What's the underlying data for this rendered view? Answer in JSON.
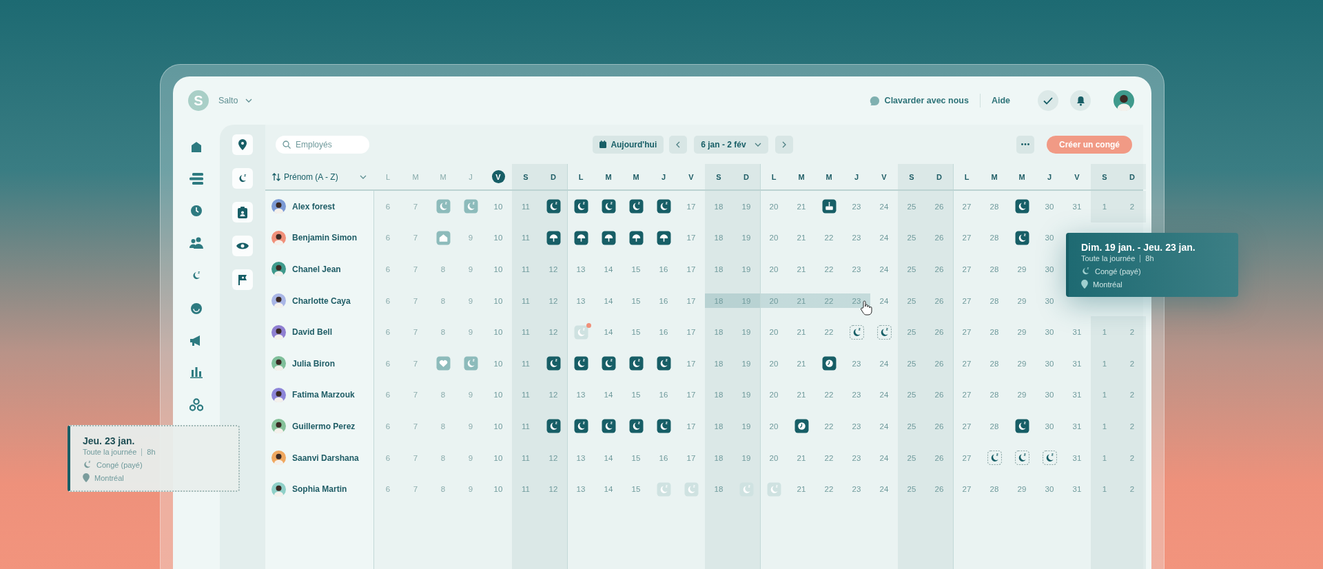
{
  "brand": {
    "initial": "S",
    "name": "Salto"
  },
  "header": {
    "chat": "Clavarder avec nous",
    "help": "Aide"
  },
  "toolbar": {
    "search": {
      "placeholder": "Employés"
    },
    "today": "Aujourd'hui",
    "range": "6 jan - 2 fév",
    "create": "Créer un congé"
  },
  "sort_label": "Prénom (A - Z)",
  "days": [
    {
      "letter": "L",
      "weekend": false,
      "past": true,
      "today": false
    },
    {
      "letter": "M",
      "weekend": false,
      "past": true,
      "today": false
    },
    {
      "letter": "M",
      "weekend": false,
      "past": true,
      "today": false
    },
    {
      "letter": "J",
      "weekend": false,
      "past": true,
      "today": false
    },
    {
      "letter": "V",
      "weekend": false,
      "past": false,
      "today": true
    },
    {
      "letter": "S",
      "weekend": true,
      "past": false,
      "today": false
    },
    {
      "letter": "D",
      "weekend": true,
      "past": false,
      "today": false
    },
    {
      "letter": "L",
      "weekend": false,
      "past": false,
      "today": false
    },
    {
      "letter": "M",
      "weekend": false,
      "past": false,
      "today": false
    },
    {
      "letter": "M",
      "weekend": false,
      "past": false,
      "today": false
    },
    {
      "letter": "J",
      "weekend": false,
      "past": false,
      "today": false
    },
    {
      "letter": "V",
      "weekend": false,
      "past": false,
      "today": false
    },
    {
      "letter": "S",
      "weekend": true,
      "past": false,
      "today": false
    },
    {
      "letter": "D",
      "weekend": true,
      "past": false,
      "today": false
    },
    {
      "letter": "L",
      "weekend": false,
      "past": false,
      "today": false
    },
    {
      "letter": "M",
      "weekend": false,
      "past": false,
      "today": false
    },
    {
      "letter": "M",
      "weekend": false,
      "past": false,
      "today": false
    },
    {
      "letter": "J",
      "weekend": false,
      "past": false,
      "today": false
    },
    {
      "letter": "V",
      "weekend": false,
      "past": false,
      "today": false
    },
    {
      "letter": "S",
      "weekend": true,
      "past": false,
      "today": false
    },
    {
      "letter": "D",
      "weekend": true,
      "past": false,
      "today": false
    },
    {
      "letter": "L",
      "weekend": false,
      "past": false,
      "today": false
    },
    {
      "letter": "M",
      "weekend": false,
      "past": false,
      "today": false
    },
    {
      "letter": "M",
      "weekend": false,
      "past": false,
      "today": false
    },
    {
      "letter": "J",
      "weekend": false,
      "past": false,
      "today": false
    },
    {
      "letter": "V",
      "weekend": false,
      "past": false,
      "today": false
    },
    {
      "letter": "S",
      "weekend": true,
      "past": false,
      "today": false
    },
    {
      "letter": "D",
      "weekend": true,
      "past": false,
      "today": false
    }
  ],
  "rows": [
    {
      "name": "Alex forest",
      "cells": [
        {
          "kind": "day",
          "text": "6",
          "selected": false
        },
        {
          "kind": "day",
          "text": "7",
          "selected": false
        },
        {
          "kind": "timeoff",
          "pending": false,
          "muted": false,
          "alert": false,
          "selected": false
        },
        {
          "kind": "timeoff",
          "pending": false,
          "muted": false,
          "alert": false,
          "selected": false
        },
        {
          "kind": "day",
          "text": "10",
          "selected": false
        },
        {
          "kind": "day",
          "text": "11",
          "selected": false
        },
        {
          "kind": "timeoff",
          "pending": false,
          "muted": false,
          "alert": false,
          "selected": false
        },
        {
          "kind": "timeoff",
          "pending": false,
          "muted": false,
          "alert": false,
          "selected": false
        },
        {
          "kind": "timeoff",
          "pending": false,
          "muted": false,
          "alert": false,
          "selected": false
        },
        {
          "kind": "timeoff",
          "pending": false,
          "muted": false,
          "alert": false,
          "selected": false
        },
        {
          "kind": "timeoff",
          "pending": false,
          "muted": false,
          "alert": false,
          "selected": false
        },
        {
          "kind": "day",
          "text": "17",
          "selected": false
        },
        {
          "kind": "day",
          "text": "18",
          "selected": false
        },
        {
          "kind": "day",
          "text": "19",
          "selected": false
        },
        {
          "kind": "day",
          "text": "20",
          "selected": false
        },
        {
          "kind": "day",
          "text": "21",
          "selected": false
        },
        {
          "kind": "birthday",
          "pending": false,
          "muted": false,
          "alert": false,
          "selected": false
        },
        {
          "kind": "day",
          "text": "23",
          "selected": false
        },
        {
          "kind": "day",
          "text": "24",
          "selected": false
        },
        {
          "kind": "day",
          "text": "25",
          "selected": false
        },
        {
          "kind": "day",
          "text": "26",
          "selected": false
        },
        {
          "kind": "day",
          "text": "27",
          "selected": false
        },
        {
          "kind": "day",
          "text": "28",
          "selected": false
        },
        {
          "kind": "timeoff",
          "pending": false,
          "muted": false,
          "alert": false,
          "selected": false
        },
        {
          "kind": "day",
          "text": "30",
          "selected": false
        },
        {
          "kind": "day",
          "text": "31",
          "selected": false
        },
        {
          "kind": "day",
          "text": "1",
          "selected": false
        },
        {
          "kind": "day",
          "text": "2",
          "selected": false
        }
      ]
    },
    {
      "name": "Benjamin Simon",
      "cells": [
        {
          "kind": "day",
          "text": "6",
          "selected": false
        },
        {
          "kind": "day",
          "text": "7",
          "selected": false
        },
        {
          "kind": "remote",
          "pending": false,
          "muted": false,
          "alert": false,
          "selected": false
        },
        {
          "kind": "day",
          "text": "9",
          "selected": false
        },
        {
          "kind": "day",
          "text": "10",
          "selected": false
        },
        {
          "kind": "day",
          "text": "11",
          "selected": false
        },
        {
          "kind": "vacation",
          "pending": false,
          "muted": false,
          "alert": false,
          "selected": false
        },
        {
          "kind": "vacation",
          "pending": false,
          "muted": false,
          "alert": false,
          "selected": false
        },
        {
          "kind": "vacation",
          "pending": false,
          "muted": false,
          "alert": false,
          "selected": false
        },
        {
          "kind": "vacation",
          "pending": false,
          "muted": false,
          "alert": false,
          "selected": false
        },
        {
          "kind": "vacation",
          "pending": false,
          "muted": false,
          "alert": false,
          "selected": false
        },
        {
          "kind": "day",
          "text": "17",
          "selected": false
        },
        {
          "kind": "day",
          "text": "18",
          "selected": false
        },
        {
          "kind": "day",
          "text": "19",
          "selected": false
        },
        {
          "kind": "day",
          "text": "20",
          "selected": false
        },
        {
          "kind": "day",
          "text": "21",
          "selected": false
        },
        {
          "kind": "day",
          "text": "22",
          "selected": false
        },
        {
          "kind": "day",
          "text": "23",
          "selected": false
        },
        {
          "kind": "day",
          "text": "24",
          "selected": false
        },
        {
          "kind": "day",
          "text": "25",
          "selected": false
        },
        {
          "kind": "day",
          "text": "26",
          "selected": false
        },
        {
          "kind": "day",
          "text": "27",
          "selected": false
        },
        {
          "kind": "day",
          "text": "28",
          "selected": false
        },
        {
          "kind": "timeoff",
          "pending": false,
          "muted": false,
          "alert": false,
          "selected": false
        },
        {
          "kind": "day",
          "text": "30",
          "selected": false
        }
      ]
    },
    {
      "name": "Chanel Jean",
      "cells": [
        {
          "kind": "day",
          "text": "6",
          "selected": false
        },
        {
          "kind": "day",
          "text": "7",
          "selected": false
        },
        {
          "kind": "day",
          "text": "8",
          "selected": false
        },
        {
          "kind": "day",
          "text": "9",
          "selected": false
        },
        {
          "kind": "day",
          "text": "10",
          "selected": false
        },
        {
          "kind": "day",
          "text": "11",
          "selected": false
        },
        {
          "kind": "day",
          "text": "12",
          "selected": false
        },
        {
          "kind": "day",
          "text": "13",
          "selected": false
        },
        {
          "kind": "day",
          "text": "14",
          "selected": false
        },
        {
          "kind": "day",
          "text": "15",
          "selected": false
        },
        {
          "kind": "day",
          "text": "16",
          "selected": false
        },
        {
          "kind": "day",
          "text": "17",
          "selected": false
        },
        {
          "kind": "day",
          "text": "18",
          "selected": false
        },
        {
          "kind": "day",
          "text": "19",
          "selected": false
        },
        {
          "kind": "day",
          "text": "20",
          "selected": false
        },
        {
          "kind": "day",
          "text": "21",
          "selected": false
        },
        {
          "kind": "day",
          "text": "22",
          "selected": false
        },
        {
          "kind": "day",
          "text": "23",
          "selected": false
        },
        {
          "kind": "day",
          "text": "24",
          "selected": false
        },
        {
          "kind": "day",
          "text": "25",
          "selected": false
        },
        {
          "kind": "day",
          "text": "26",
          "selected": false
        },
        {
          "kind": "day",
          "text": "27",
          "selected": false
        },
        {
          "kind": "day",
          "text": "28",
          "selected": false
        },
        {
          "kind": "day",
          "text": "29",
          "selected": false
        },
        {
          "kind": "day",
          "text": "30",
          "selected": false
        }
      ]
    },
    {
      "name": "Charlotte Caya",
      "cells": [
        {
          "kind": "day",
          "text": "6",
          "selected": false
        },
        {
          "kind": "day",
          "text": "7",
          "selected": false
        },
        {
          "kind": "day",
          "text": "8",
          "selected": false
        },
        {
          "kind": "day",
          "text": "9",
          "selected": false
        },
        {
          "kind": "day",
          "text": "10",
          "selected": false
        },
        {
          "kind": "day",
          "text": "11",
          "selected": false
        },
        {
          "kind": "day",
          "text": "12",
          "selected": false
        },
        {
          "kind": "day",
          "text": "13",
          "selected": false
        },
        {
          "kind": "day",
          "text": "14",
          "selected": false
        },
        {
          "kind": "day",
          "text": "15",
          "selected": false
        },
        {
          "kind": "day",
          "text": "16",
          "selected": false
        },
        {
          "kind": "day",
          "text": "17",
          "selected": false
        },
        {
          "kind": "day",
          "text": "18",
          "selected": true
        },
        {
          "kind": "day",
          "text": "19",
          "selected": true
        },
        {
          "kind": "day",
          "text": "20",
          "selected": true
        },
        {
          "kind": "day",
          "text": "21",
          "selected": true
        },
        {
          "kind": "day",
          "text": "22",
          "selected": true
        },
        {
          "kind": "day",
          "text": "23",
          "selected": true
        },
        {
          "kind": "day",
          "text": "24",
          "selected": false
        },
        {
          "kind": "day",
          "text": "25",
          "selected": false
        },
        {
          "kind": "day",
          "text": "26",
          "selected": false
        },
        {
          "kind": "day",
          "text": "27",
          "selected": false
        },
        {
          "kind": "day",
          "text": "28",
          "selected": false
        },
        {
          "kind": "day",
          "text": "29",
          "selected": false
        },
        {
          "kind": "day",
          "text": "30",
          "selected": false
        }
      ]
    },
    {
      "name": "David Bell",
      "cells": [
        {
          "kind": "day",
          "text": "6",
          "selected": false
        },
        {
          "kind": "day",
          "text": "7",
          "selected": false
        },
        {
          "kind": "day",
          "text": "8",
          "selected": false
        },
        {
          "kind": "day",
          "text": "9",
          "selected": false
        },
        {
          "kind": "day",
          "text": "10",
          "selected": false
        },
        {
          "kind": "day",
          "text": "11",
          "selected": false
        },
        {
          "kind": "day",
          "text": "12",
          "selected": false
        },
        {
          "kind": "timeoff",
          "pending": false,
          "muted": true,
          "alert": true,
          "selected": false
        },
        {
          "kind": "day",
          "text": "14",
          "selected": false
        },
        {
          "kind": "day",
          "text": "15",
          "selected": false
        },
        {
          "kind": "day",
          "text": "16",
          "selected": false
        },
        {
          "kind": "day",
          "text": "17",
          "selected": false
        },
        {
          "kind": "day",
          "text": "18",
          "selected": false
        },
        {
          "kind": "day",
          "text": "19",
          "selected": false
        },
        {
          "kind": "day",
          "text": "20",
          "selected": false
        },
        {
          "kind": "day",
          "text": "21",
          "selected": false
        },
        {
          "kind": "day",
          "text": "22",
          "selected": false
        },
        {
          "kind": "timeoff",
          "pending": true,
          "muted": false,
          "alert": false,
          "selected": false
        },
        {
          "kind": "timeoff",
          "pending": true,
          "muted": false,
          "alert": false,
          "selected": false
        },
        {
          "kind": "day",
          "text": "25",
          "selected": false
        },
        {
          "kind": "day",
          "text": "26",
          "selected": false
        },
        {
          "kind": "day",
          "text": "27",
          "selected": false
        },
        {
          "kind": "day",
          "text": "28",
          "selected": false
        },
        {
          "kind": "day",
          "text": "29",
          "selected": false
        },
        {
          "kind": "day",
          "text": "30",
          "selected": false
        },
        {
          "kind": "day",
          "text": "31",
          "selected": false
        },
        {
          "kind": "day",
          "text": "1",
          "selected": false
        },
        {
          "kind": "day",
          "text": "2",
          "selected": false
        }
      ]
    },
    {
      "name": "Julia Biron",
      "cells": [
        {
          "kind": "day",
          "text": "6",
          "selected": false
        },
        {
          "kind": "day",
          "text": "7",
          "selected": false
        },
        {
          "kind": "wellness",
          "pending": false,
          "muted": false,
          "alert": false,
          "selected": false
        },
        {
          "kind": "timeoff",
          "pending": false,
          "muted": false,
          "alert": false,
          "selected": false
        },
        {
          "kind": "day",
          "text": "10",
          "selected": false
        },
        {
          "kind": "day",
          "text": "11",
          "selected": false
        },
        {
          "kind": "timeoff",
          "pending": false,
          "muted": false,
          "alert": false,
          "selected": false
        },
        {
          "kind": "timeoff",
          "pending": false,
          "muted": false,
          "alert": false,
          "selected": false
        },
        {
          "kind": "timeoff",
          "pending": false,
          "muted": false,
          "alert": false,
          "selected": false
        },
        {
          "kind": "timeoff",
          "pending": false,
          "muted": false,
          "alert": false,
          "selected": false
        },
        {
          "kind": "timeoff",
          "pending": false,
          "muted": false,
          "alert": false,
          "selected": false
        },
        {
          "kind": "day",
          "text": "17",
          "selected": false
        },
        {
          "kind": "day",
          "text": "18",
          "selected": false
        },
        {
          "kind": "day",
          "text": "19",
          "selected": false
        },
        {
          "kind": "day",
          "text": "20",
          "selected": false
        },
        {
          "kind": "day",
          "text": "21",
          "selected": false
        },
        {
          "kind": "overtime",
          "pending": false,
          "muted": false,
          "alert": false,
          "selected": false
        },
        {
          "kind": "day",
          "text": "23",
          "selected": false
        },
        {
          "kind": "day",
          "text": "24",
          "selected": false
        },
        {
          "kind": "day",
          "text": "25",
          "selected": false
        },
        {
          "kind": "day",
          "text": "26",
          "selected": false
        },
        {
          "kind": "day",
          "text": "27",
          "selected": false
        },
        {
          "kind": "day",
          "text": "28",
          "selected": false
        },
        {
          "kind": "day",
          "text": "29",
          "selected": false
        },
        {
          "kind": "day",
          "text": "30",
          "selected": false
        },
        {
          "kind": "day",
          "text": "31",
          "selected": false
        },
        {
          "kind": "day",
          "text": "1",
          "selected": false
        },
        {
          "kind": "day",
          "text": "2",
          "selected": false
        }
      ]
    },
    {
      "name": "Fatima Marzouk",
      "cells": [
        {
          "kind": "day",
          "text": "6",
          "selected": false
        },
        {
          "kind": "day",
          "text": "7",
          "selected": false
        },
        {
          "kind": "day",
          "text": "8",
          "selected": false
        },
        {
          "kind": "day",
          "text": "9",
          "selected": false
        },
        {
          "kind": "day",
          "text": "10",
          "selected": false
        },
        {
          "kind": "day",
          "text": "11",
          "selected": false
        },
        {
          "kind": "day",
          "text": "12",
          "selected": false
        },
        {
          "kind": "day",
          "text": "13",
          "selected": false
        },
        {
          "kind": "day",
          "text": "14",
          "selected": false
        },
        {
          "kind": "day",
          "text": "15",
          "selected": false
        },
        {
          "kind": "day",
          "text": "16",
          "selected": false
        },
        {
          "kind": "day",
          "text": "17",
          "selected": false
        },
        {
          "kind": "day",
          "text": "18",
          "selected": false
        },
        {
          "kind": "day",
          "text": "19",
          "selected": false
        },
        {
          "kind": "day",
          "text": "20",
          "selected": false
        },
        {
          "kind": "day",
          "text": "21",
          "selected": false
        },
        {
          "kind": "day",
          "text": "22",
          "selected": false
        },
        {
          "kind": "day",
          "text": "23",
          "selected": false
        },
        {
          "kind": "day",
          "text": "24",
          "selected": false
        },
        {
          "kind": "day",
          "text": "25",
          "selected": false
        },
        {
          "kind": "day",
          "text": "26",
          "selected": false
        },
        {
          "kind": "day",
          "text": "27",
          "selected": false
        },
        {
          "kind": "day",
          "text": "28",
          "selected": false
        },
        {
          "kind": "day",
          "text": "29",
          "selected": false
        },
        {
          "kind": "day",
          "text": "30",
          "selected": false
        },
        {
          "kind": "day",
          "text": "31",
          "selected": false
        },
        {
          "kind": "day",
          "text": "1",
          "selected": false
        },
        {
          "kind": "day",
          "text": "2",
          "selected": false
        }
      ]
    },
    {
      "name": "Guillermo Perez",
      "cells": [
        {
          "kind": "day",
          "text": "6",
          "selected": false
        },
        {
          "kind": "day",
          "text": "7",
          "selected": false
        },
        {
          "kind": "day",
          "text": "8",
          "selected": false
        },
        {
          "kind": "day",
          "text": "9",
          "selected": false
        },
        {
          "kind": "day",
          "text": "10",
          "selected": false
        },
        {
          "kind": "day",
          "text": "11",
          "selected": false
        },
        {
          "kind": "timeoff",
          "pending": false,
          "muted": false,
          "alert": false,
          "selected": false
        },
        {
          "kind": "timeoff",
          "pending": false,
          "muted": false,
          "alert": false,
          "selected": false
        },
        {
          "kind": "timeoff",
          "pending": false,
          "muted": false,
          "alert": false,
          "selected": false
        },
        {
          "kind": "timeoff",
          "pending": false,
          "muted": false,
          "alert": false,
          "selected": false
        },
        {
          "kind": "timeoff",
          "pending": false,
          "muted": false,
          "alert": false,
          "selected": false
        },
        {
          "kind": "day",
          "text": "17",
          "selected": false
        },
        {
          "kind": "day",
          "text": "18",
          "selected": false
        },
        {
          "kind": "day",
          "text": "19",
          "selected": false
        },
        {
          "kind": "day",
          "text": "20",
          "selected": false
        },
        {
          "kind": "overtime",
          "pending": false,
          "muted": false,
          "alert": false,
          "selected": false
        },
        {
          "kind": "day",
          "text": "22",
          "selected": false
        },
        {
          "kind": "day",
          "text": "23",
          "selected": false
        },
        {
          "kind": "day",
          "text": "24",
          "selected": false
        },
        {
          "kind": "day",
          "text": "25",
          "selected": false
        },
        {
          "kind": "day",
          "text": "26",
          "selected": false
        },
        {
          "kind": "day",
          "text": "27",
          "selected": false
        },
        {
          "kind": "day",
          "text": "28",
          "selected": false
        },
        {
          "kind": "timeoff",
          "pending": false,
          "muted": false,
          "alert": false,
          "selected": false
        },
        {
          "kind": "day",
          "text": "30",
          "selected": false
        },
        {
          "kind": "day",
          "text": "31",
          "selected": false
        },
        {
          "kind": "day",
          "text": "1",
          "selected": false
        },
        {
          "kind": "day",
          "text": "2",
          "selected": false
        }
      ]
    },
    {
      "name": "Saanvi Darshana",
      "cells": [
        {
          "kind": "day",
          "text": "6",
          "selected": false
        },
        {
          "kind": "day",
          "text": "7",
          "selected": false
        },
        {
          "kind": "day",
          "text": "8",
          "selected": false
        },
        {
          "kind": "day",
          "text": "9",
          "selected": false
        },
        {
          "kind": "day",
          "text": "10",
          "selected": false
        },
        {
          "kind": "day",
          "text": "11",
          "selected": false
        },
        {
          "kind": "day",
          "text": "12",
          "selected": false
        },
        {
          "kind": "day",
          "text": "13",
          "selected": false
        },
        {
          "kind": "day",
          "text": "14",
          "selected": false
        },
        {
          "kind": "day",
          "text": "15",
          "selected": false
        },
        {
          "kind": "day",
          "text": "16",
          "selected": false
        },
        {
          "kind": "day",
          "text": "17",
          "selected": false
        },
        {
          "kind": "day",
          "text": "18",
          "selected": false
        },
        {
          "kind": "day",
          "text": "19",
          "selected": false
        },
        {
          "kind": "day",
          "text": "20",
          "selected": false
        },
        {
          "kind": "day",
          "text": "21",
          "selected": false
        },
        {
          "kind": "day",
          "text": "22",
          "selected": false
        },
        {
          "kind": "day",
          "text": "23",
          "selected": false
        },
        {
          "kind": "day",
          "text": "24",
          "selected": false
        },
        {
          "kind": "day",
          "text": "25",
          "selected": false
        },
        {
          "kind": "day",
          "text": "26",
          "selected": false
        },
        {
          "kind": "day",
          "text": "27",
          "selected": false
        },
        {
          "kind": "timeoff",
          "pending": true,
          "muted": false,
          "alert": false,
          "selected": false
        },
        {
          "kind": "timeoff",
          "pending": true,
          "muted": false,
          "alert": false,
          "selected": false
        },
        {
          "kind": "timeoff",
          "pending": true,
          "muted": false,
          "alert": false,
          "selected": false
        },
        {
          "kind": "day",
          "text": "31",
          "selected": false
        },
        {
          "kind": "day",
          "text": "1",
          "selected": false
        },
        {
          "kind": "day",
          "text": "2",
          "selected": false
        }
      ]
    },
    {
      "name": "Sophia Martin",
      "cells": [
        {
          "kind": "day",
          "text": "6",
          "selected": false
        },
        {
          "kind": "day",
          "text": "7",
          "selected": false
        },
        {
          "kind": "day",
          "text": "8",
          "selected": false
        },
        {
          "kind": "day",
          "text": "9",
          "selected": false
        },
        {
          "kind": "day",
          "text": "10",
          "selected": false
        },
        {
          "kind": "day",
          "text": "11",
          "selected": false
        },
        {
          "kind": "day",
          "text": "12",
          "selected": false
        },
        {
          "kind": "day",
          "text": "13",
          "selected": false
        },
        {
          "kind": "day",
          "text": "14",
          "selected": false
        },
        {
          "kind": "day",
          "text": "15",
          "selected": false
        },
        {
          "kind": "timeoff",
          "pending": false,
          "muted": true,
          "alert": false,
          "selected": false
        },
        {
          "kind": "timeoff",
          "pending": false,
          "muted": true,
          "alert": false,
          "selected": false
        },
        {
          "kind": "day",
          "text": "18",
          "selected": false
        },
        {
          "kind": "timeoff",
          "pending": false,
          "muted": true,
          "alert": false,
          "selected": false
        },
        {
          "kind": "timeoff",
          "pending": false,
          "muted": true,
          "alert": false,
          "selected": false
        },
        {
          "kind": "day",
          "text": "21",
          "selected": false
        },
        {
          "kind": "day",
          "text": "22",
          "selected": false
        },
        {
          "kind": "day",
          "text": "23",
          "selected": false
        },
        {
          "kind": "day",
          "text": "24",
          "selected": false
        },
        {
          "kind": "day",
          "text": "25",
          "selected": false
        },
        {
          "kind": "day",
          "text": "26",
          "selected": false
        },
        {
          "kind": "day",
          "text": "27",
          "selected": false
        },
        {
          "kind": "day",
          "text": "28",
          "selected": false
        },
        {
          "kind": "day",
          "text": "29",
          "selected": false
        },
        {
          "kind": "day",
          "text": "30",
          "selected": false
        },
        {
          "kind": "day",
          "text": "31",
          "selected": false
        },
        {
          "kind": "day",
          "text": "1",
          "selected": false
        },
        {
          "kind": "day",
          "text": "2",
          "selected": false
        }
      ]
    }
  ],
  "tooltips": [
    {
      "kind": "approved",
      "title": "Dim. 19 jan. - Jeu. 23 jan.",
      "duration": "Toute la journée",
      "hours": "8h",
      "type": "Congé (payé)",
      "location": "Montréal"
    },
    {
      "kind": "pending",
      "title": "Jeu. 23 jan.",
      "duration": "Toute la journée",
      "hours": "8h",
      "type": "Congé (payé)",
      "location": "Montréal"
    }
  ]
}
